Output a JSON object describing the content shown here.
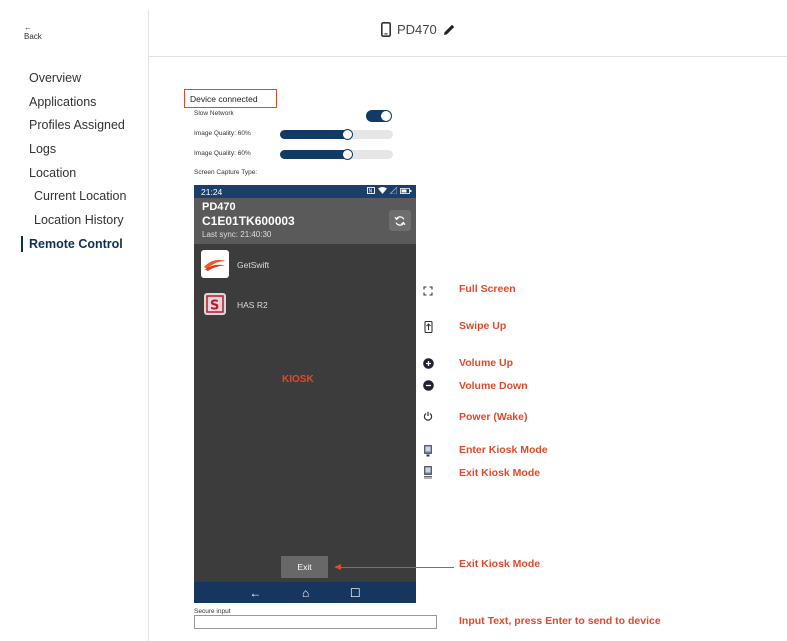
{
  "header": {
    "back_arrow": "←",
    "back_label": "Back",
    "device_icon": "phone-icon",
    "device_name": "PD470",
    "edit_icon": "pencil-icon"
  },
  "sidebar": {
    "items": [
      {
        "label": "Overview"
      },
      {
        "label": "Applications"
      },
      {
        "label": "Profiles Assigned"
      },
      {
        "label": "Logs"
      },
      {
        "label": "Location"
      },
      {
        "label": "Current Location"
      },
      {
        "label": "Location History"
      },
      {
        "label": "Remote Control",
        "active": true
      }
    ]
  },
  "remote": {
    "status": "Device connected",
    "slow_network_label": "Slow Network",
    "slow_network_on": true,
    "image_quality_1_label": "Image Quality: 60%",
    "image_quality_1_value": 60,
    "image_quality_2_label": "Image Quality: 60%",
    "image_quality_2_value": 60,
    "capture_type_label": "Screen Capture Type:"
  },
  "phone": {
    "time": "21:24",
    "device_name": "PD470",
    "serial": "C1E01TK600003",
    "last_sync": "Last sync: 21:40:30",
    "apps": [
      {
        "name": "GetSwift",
        "icon": "getswift-logo"
      },
      {
        "name": "HAS R2",
        "icon": "has-logo"
      }
    ],
    "kiosk_label": "KIOSK",
    "exit_button": "Exit",
    "nav": {
      "back": "←",
      "home": "⌂",
      "recents": "☐"
    }
  },
  "controls": [
    {
      "label": "Full Screen",
      "icon": "fullscreen-icon"
    },
    {
      "label": "Swipe Up",
      "icon": "swipe-up-icon"
    },
    {
      "label": "Volume Up",
      "icon": "volume-up-icon"
    },
    {
      "label": "Volume Down",
      "icon": "volume-down-icon"
    },
    {
      "label": "Power (Wake)",
      "icon": "power-icon"
    },
    {
      "label": "Enter Kiosk Mode",
      "icon": "enter-kiosk-icon"
    },
    {
      "label": "Exit Kiosk Mode",
      "icon": "exit-kiosk-icon"
    }
  ],
  "annotations": {
    "exit_kiosk": "Exit Kiosk Mode",
    "input_hint": "Input Text, press Enter to send to device"
  },
  "secure_input": {
    "label": "Secure input",
    "value": ""
  },
  "colors": {
    "accent": "#e0492b",
    "navy": "#123a66",
    "phone_bg": "#3c3c3c"
  }
}
